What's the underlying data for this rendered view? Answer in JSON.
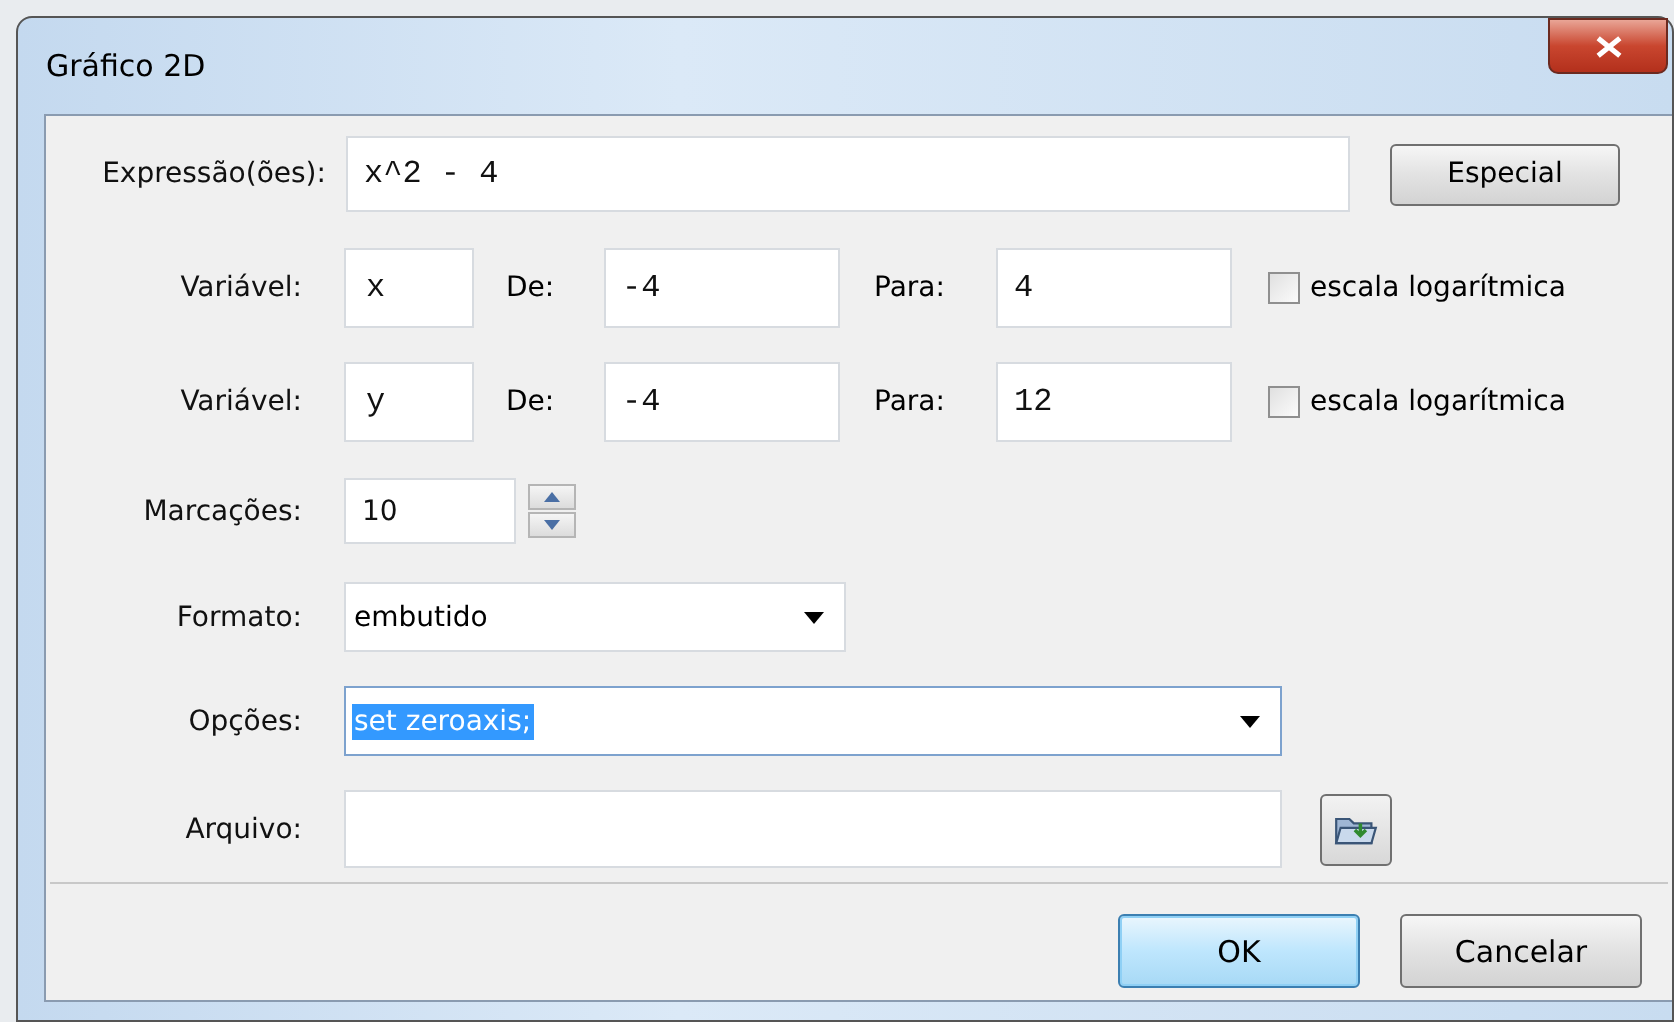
{
  "window": {
    "title": "Gráfico 2D"
  },
  "expression": {
    "label": "Expressão(ões):",
    "value": "x^2 - 4"
  },
  "special_button": "Especial",
  "variables": [
    {
      "label": "Variável:",
      "value": "x",
      "from_label": "De:",
      "from": "-4",
      "to_label": "Para:",
      "to": "4",
      "log_label": "escala logarítmica",
      "log_checked": false
    },
    {
      "label": "Variável:",
      "value": "y",
      "from_label": "De:",
      "from": "-4",
      "to_label": "Para:",
      "to": "12",
      "log_label": "escala logarítmica",
      "log_checked": false
    }
  ],
  "ticks": {
    "label": "Marcações:",
    "value": "10"
  },
  "format": {
    "label": "Formato:",
    "value": "embutido"
  },
  "options": {
    "label": "Opções:",
    "value": "set zeroaxis;",
    "text_selected": true
  },
  "file": {
    "label": "Arquivo:"
  },
  "buttons": [
    {
      "label": "OK",
      "default": true
    },
    {
      "label": "Cancelar",
      "default": false
    }
  ]
}
